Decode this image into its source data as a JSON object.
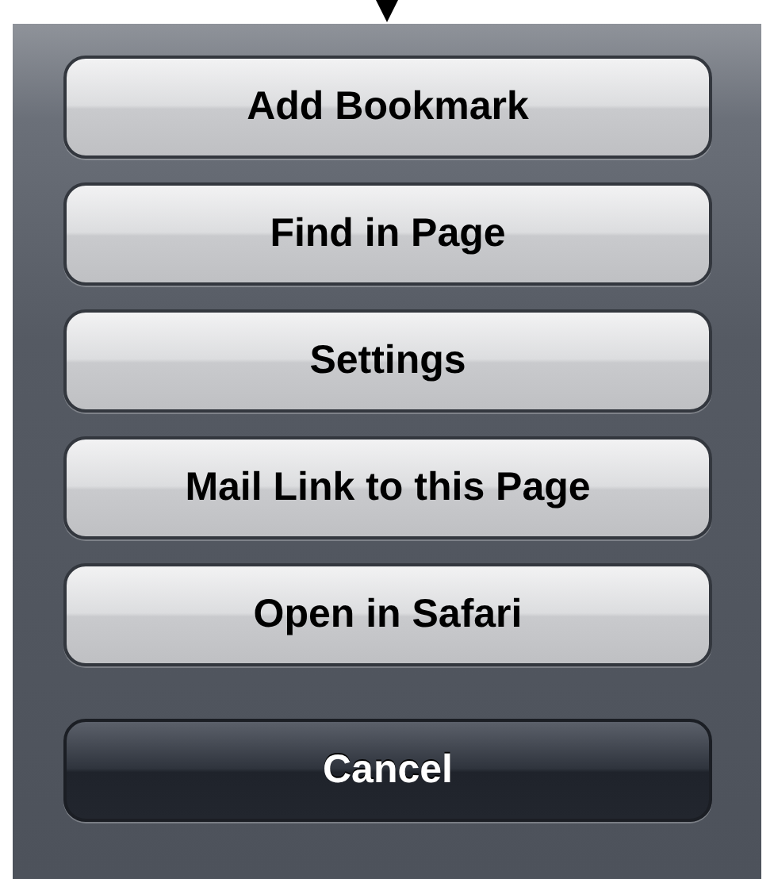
{
  "action_sheet": {
    "buttons": [
      {
        "label": "Add Bookmark",
        "kind": "default"
      },
      {
        "label": "Find in Page",
        "kind": "default"
      },
      {
        "label": "Settings",
        "kind": "default"
      },
      {
        "label": "Mail Link to this Page",
        "kind": "default"
      },
      {
        "label": "Open in Safari",
        "kind": "default"
      },
      {
        "label": "Cancel",
        "kind": "cancel"
      }
    ]
  }
}
